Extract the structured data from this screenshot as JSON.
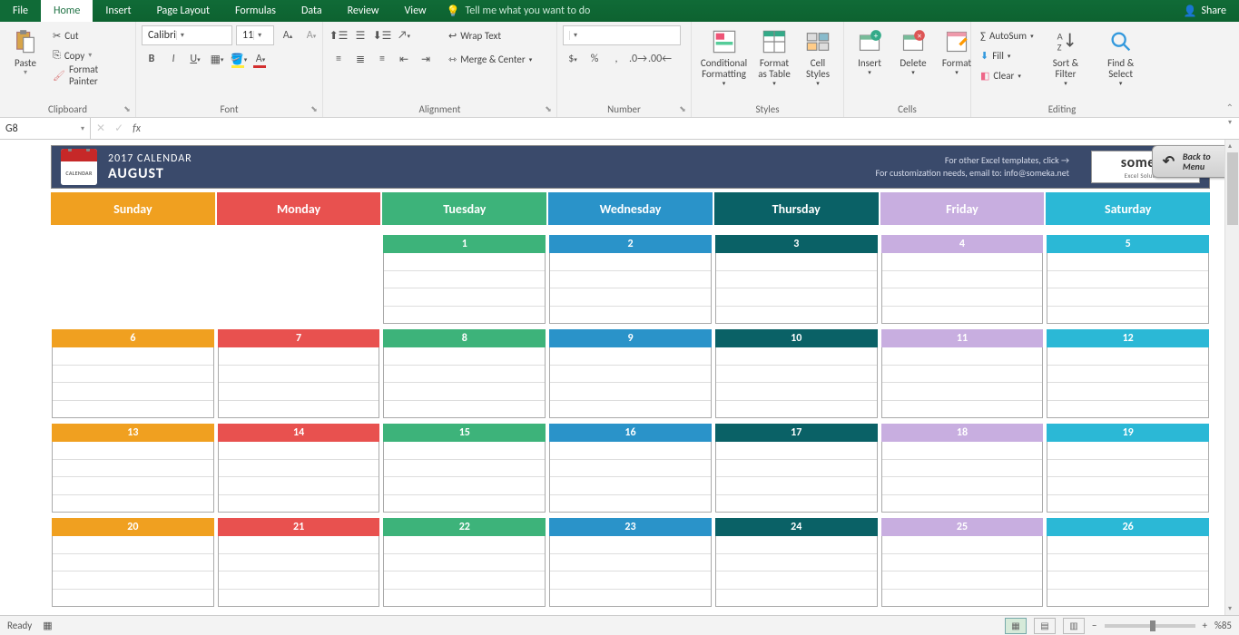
{
  "menu": {
    "file": "File",
    "home": "Home",
    "insert": "Insert",
    "pagelayout": "Page Layout",
    "formulas": "Formulas",
    "data": "Data",
    "review": "Review",
    "view": "View",
    "tellme": "Tell me what you want to do",
    "share": "Share"
  },
  "ribbon": {
    "clipboard": {
      "label": "Clipboard",
      "paste": "Paste",
      "cut": "Cut",
      "copy": "Copy",
      "format_painter": "Format Painter"
    },
    "font": {
      "label": "Font",
      "name": "Calibri",
      "size": "11"
    },
    "alignment": {
      "label": "Alignment",
      "wrap": "Wrap Text",
      "merge": "Merge & Center"
    },
    "number": {
      "label": "Number",
      "format": ""
    },
    "styles": {
      "label": "Styles",
      "cond": "Conditional Formatting",
      "fat": "Format as Table",
      "cell": "Cell Styles"
    },
    "cells": {
      "label": "Cells",
      "insert": "Insert",
      "delete": "Delete",
      "format": "Format"
    },
    "editing": {
      "label": "Editing",
      "autosum": "AutoSum",
      "fill": "Fill",
      "clear": "Clear",
      "sort": "Sort & Filter",
      "find": "Find & Select"
    }
  },
  "namebox": "G8",
  "calendar": {
    "year": "2017 CALENDAR",
    "month": "AUGUST",
    "ical": "CALENDAR",
    "line1": "For other Excel templates, click →",
    "line2": "For customization needs, email to: info@someka.net",
    "logo": "someka",
    "logo_sub": "Excel Solutions",
    "back": "Back to Menu",
    "days": [
      "Sunday",
      "Monday",
      "Tuesday",
      "Wednesday",
      "Thursday",
      "Friday",
      "Saturday"
    ],
    "weeks": [
      [
        "",
        "",
        "1",
        "2",
        "3",
        "4",
        "5"
      ],
      [
        "6",
        "7",
        "8",
        "9",
        "10",
        "11",
        "12"
      ],
      [
        "13",
        "14",
        "15",
        "16",
        "17",
        "18",
        "19"
      ],
      [
        "20",
        "21",
        "22",
        "23",
        "24",
        "25",
        "26"
      ]
    ]
  },
  "status": {
    "ready": "Ready",
    "zoom": "%85"
  }
}
